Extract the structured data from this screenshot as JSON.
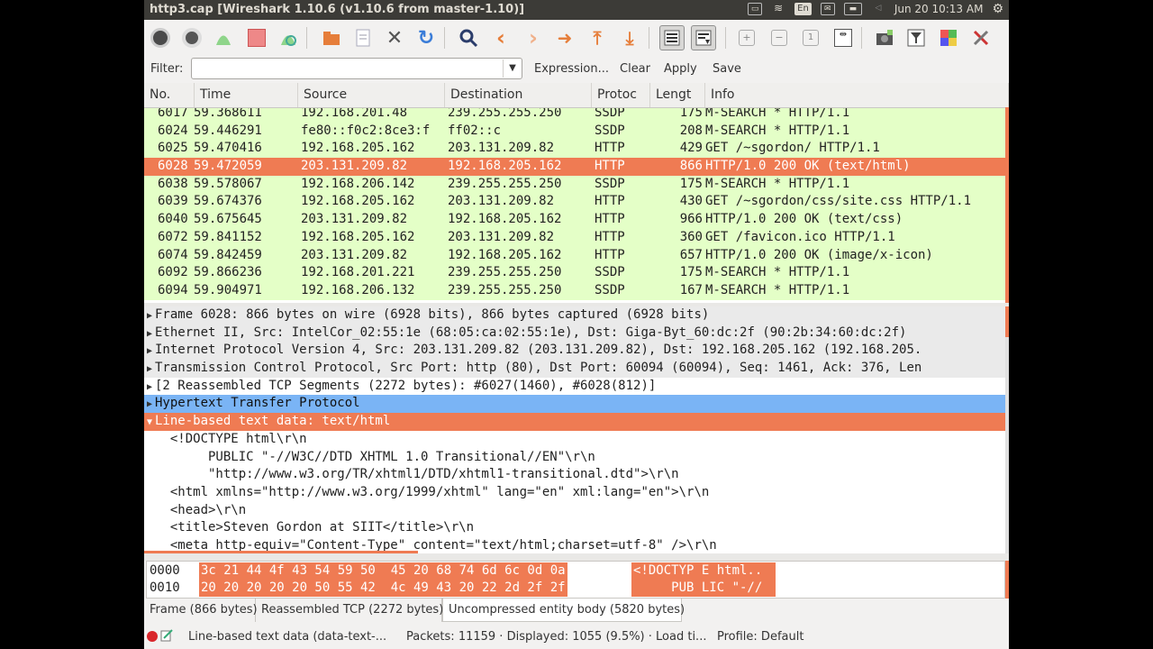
{
  "window": {
    "title": "http3.cap  [Wireshark 1.10.6  (v1.10.6 from master-1.10)]"
  },
  "tray": {
    "language": "En",
    "clock": "Jun 20 10:13 AM"
  },
  "colors": {
    "selected_row": "#ef7b53",
    "list_row_bg": "#e4ffc7",
    "highlight_blue": "#7ab4f5",
    "panel_bg": "#3c3b37"
  },
  "toolbar_icons": [
    "interface-list-icon",
    "capture-options-icon",
    "start-capture-icon",
    "stop-capture-icon",
    "restart-capture-icon",
    "open-file-icon",
    "save-file-icon",
    "close-file-icon",
    "reload-icon",
    "find-packet-icon",
    "go-back-icon",
    "go-forward-icon",
    "go-to-packet-icon",
    "go-first-icon",
    "go-last-icon",
    "colorize-icon",
    "auto-scroll-icon",
    "zoom-in-icon",
    "zoom-out-icon",
    "zoom-normal-icon",
    "resize-columns-icon",
    "capture-filters-icon",
    "display-filters-icon",
    "coloring-rules-icon",
    "preferences-icon"
  ],
  "filter": {
    "label": "Filter:",
    "value": "",
    "expression": "Expression...",
    "clear": "Clear",
    "apply": "Apply",
    "save": "Save"
  },
  "packet_list": {
    "columns": [
      "No.",
      "Time",
      "Source",
      "Destination",
      "Protoc",
      "Lengt",
      "Info"
    ],
    "rows": [
      {
        "no": "6017",
        "time": "59.368611",
        "src": "192.168.201.48",
        "dst": "239.255.255.250",
        "proto": "SSDP",
        "len": "175",
        "info": "M-SEARCH * HTTP/1.1"
      },
      {
        "no": "6024",
        "time": "59.446291",
        "src": "fe80::f0c2:8ce3:f",
        "dst": "ff02::c",
        "proto": "SSDP",
        "len": "208",
        "info": "M-SEARCH * HTTP/1.1"
      },
      {
        "no": "6025",
        "time": "59.470416",
        "src": "192.168.205.162",
        "dst": "203.131.209.82",
        "proto": "HTTP",
        "len": "429",
        "info": "GET /~sgordon/ HTTP/1.1"
      },
      {
        "no": "6028",
        "time": "59.472059",
        "src": "203.131.209.82",
        "dst": "192.168.205.162",
        "proto": "HTTP",
        "len": "866",
        "info": "HTTP/1.0 200 OK  (text/html)",
        "selected": true
      },
      {
        "no": "6038",
        "time": "59.578067",
        "src": "192.168.206.142",
        "dst": "239.255.255.250",
        "proto": "SSDP",
        "len": "175",
        "info": "M-SEARCH * HTTP/1.1"
      },
      {
        "no": "6039",
        "time": "59.674376",
        "src": "192.168.205.162",
        "dst": "203.131.209.82",
        "proto": "HTTP",
        "len": "430",
        "info": "GET /~sgordon/css/site.css HTTP/1.1"
      },
      {
        "no": "6040",
        "time": "59.675645",
        "src": "203.131.209.82",
        "dst": "192.168.205.162",
        "proto": "HTTP",
        "len": "966",
        "info": "HTTP/1.0 200 OK  (text/css)"
      },
      {
        "no": "6072",
        "time": "59.841152",
        "src": "192.168.205.162",
        "dst": "203.131.209.82",
        "proto": "HTTP",
        "len": "360",
        "info": "GET /favicon.ico HTTP/1.1"
      },
      {
        "no": "6074",
        "time": "59.842459",
        "src": "203.131.209.82",
        "dst": "192.168.205.162",
        "proto": "HTTP",
        "len": "657",
        "info": "HTTP/1.0 200 OK  (image/x-icon)"
      },
      {
        "no": "6092",
        "time": "59.866236",
        "src": "192.168.201.221",
        "dst": "239.255.255.250",
        "proto": "SSDP",
        "len": "175",
        "info": "M-SEARCH * HTTP/1.1"
      },
      {
        "no": "6094",
        "time": "59.904971",
        "src": "192.168.206.132",
        "dst": "239.255.255.250",
        "proto": "SSDP",
        "len": "167",
        "info": "M-SEARCH * HTTP/1.1"
      }
    ]
  },
  "details": [
    {
      "arrow": "▶",
      "text": "Frame 6028: 866 bytes on wire (6928 bits), 866 bytes captured (6928 bits)",
      "style": "grey"
    },
    {
      "arrow": "▶",
      "text": "Ethernet II, Src: IntelCor_02:55:1e (68:05:ca:02:55:1e), Dst: Giga-Byt_60:dc:2f (90:2b:34:60:dc:2f)",
      "style": "grey"
    },
    {
      "arrow": "▶",
      "text": "Internet Protocol Version 4, Src: 203.131.209.82 (203.131.209.82), Dst: 192.168.205.162 (192.168.205.",
      "style": "grey"
    },
    {
      "arrow": "▶",
      "text": "Transmission Control Protocol, Src Port: http (80), Dst Port: 60094 (60094), Seq: 1461, Ack: 376, Len",
      "style": "grey"
    },
    {
      "arrow": "▶",
      "text": "[2 Reassembled TCP Segments (2272 bytes): #6027(1460), #6028(812)]",
      "style": "plain"
    },
    {
      "arrow": "▶",
      "text": "Hypertext Transfer Protocol",
      "style": "blue"
    },
    {
      "arrow": "▼",
      "text": "Line-based text data: text/html",
      "style": "orange"
    },
    {
      "arrow": "",
      "text": "  <!DOCTYPE html\\r\\n",
      "style": "plain"
    },
    {
      "arrow": "",
      "text": "       PUBLIC \"-//W3C//DTD XHTML 1.0 Transitional//EN\"\\r\\n",
      "style": "plain"
    },
    {
      "arrow": "",
      "text": "       \"http://www.w3.org/TR/xhtml1/DTD/xhtml1-transitional.dtd\">\\r\\n",
      "style": "plain"
    },
    {
      "arrow": "",
      "text": "  <html xmlns=\"http://www.w3.org/1999/xhtml\" lang=\"en\" xml:lang=\"en\">\\r\\n",
      "style": "plain"
    },
    {
      "arrow": "",
      "text": "  <head>\\r\\n",
      "style": "plain"
    },
    {
      "arrow": "",
      "text": "  <title>Steven Gordon at SIIT</title>\\r\\n",
      "style": "plain"
    },
    {
      "arrow": "",
      "text": "  <meta http-equiv=\"Content-Type\" content=\"text/html;charset=utf-8\" />\\r\\n",
      "style": "plain"
    }
  ],
  "bytes": [
    {
      "offset": "0000",
      "hex": "3c 21 44 4f 43 54 59 50  45 20 68 74 6d 6c 0d 0a",
      "ascii": "<!DOCTYP E html.."
    },
    {
      "offset": "0010",
      "hex": "20 20 20 20 20 50 55 42  4c 49 43 20 22 2d 2f 2f",
      "ascii": "     PUB LIC \"-//"
    }
  ],
  "byte_tabs": [
    "Frame (866 bytes)",
    "Reassembled TCP (2272 bytes)",
    "Uncompressed entity body (5820 bytes)"
  ],
  "status": {
    "field": "Line-based text data (data-text-...",
    "packets": "Packets: 11159 · Displayed: 1055 (9.5%) · Load ti...",
    "profile": "Profile: Default"
  }
}
